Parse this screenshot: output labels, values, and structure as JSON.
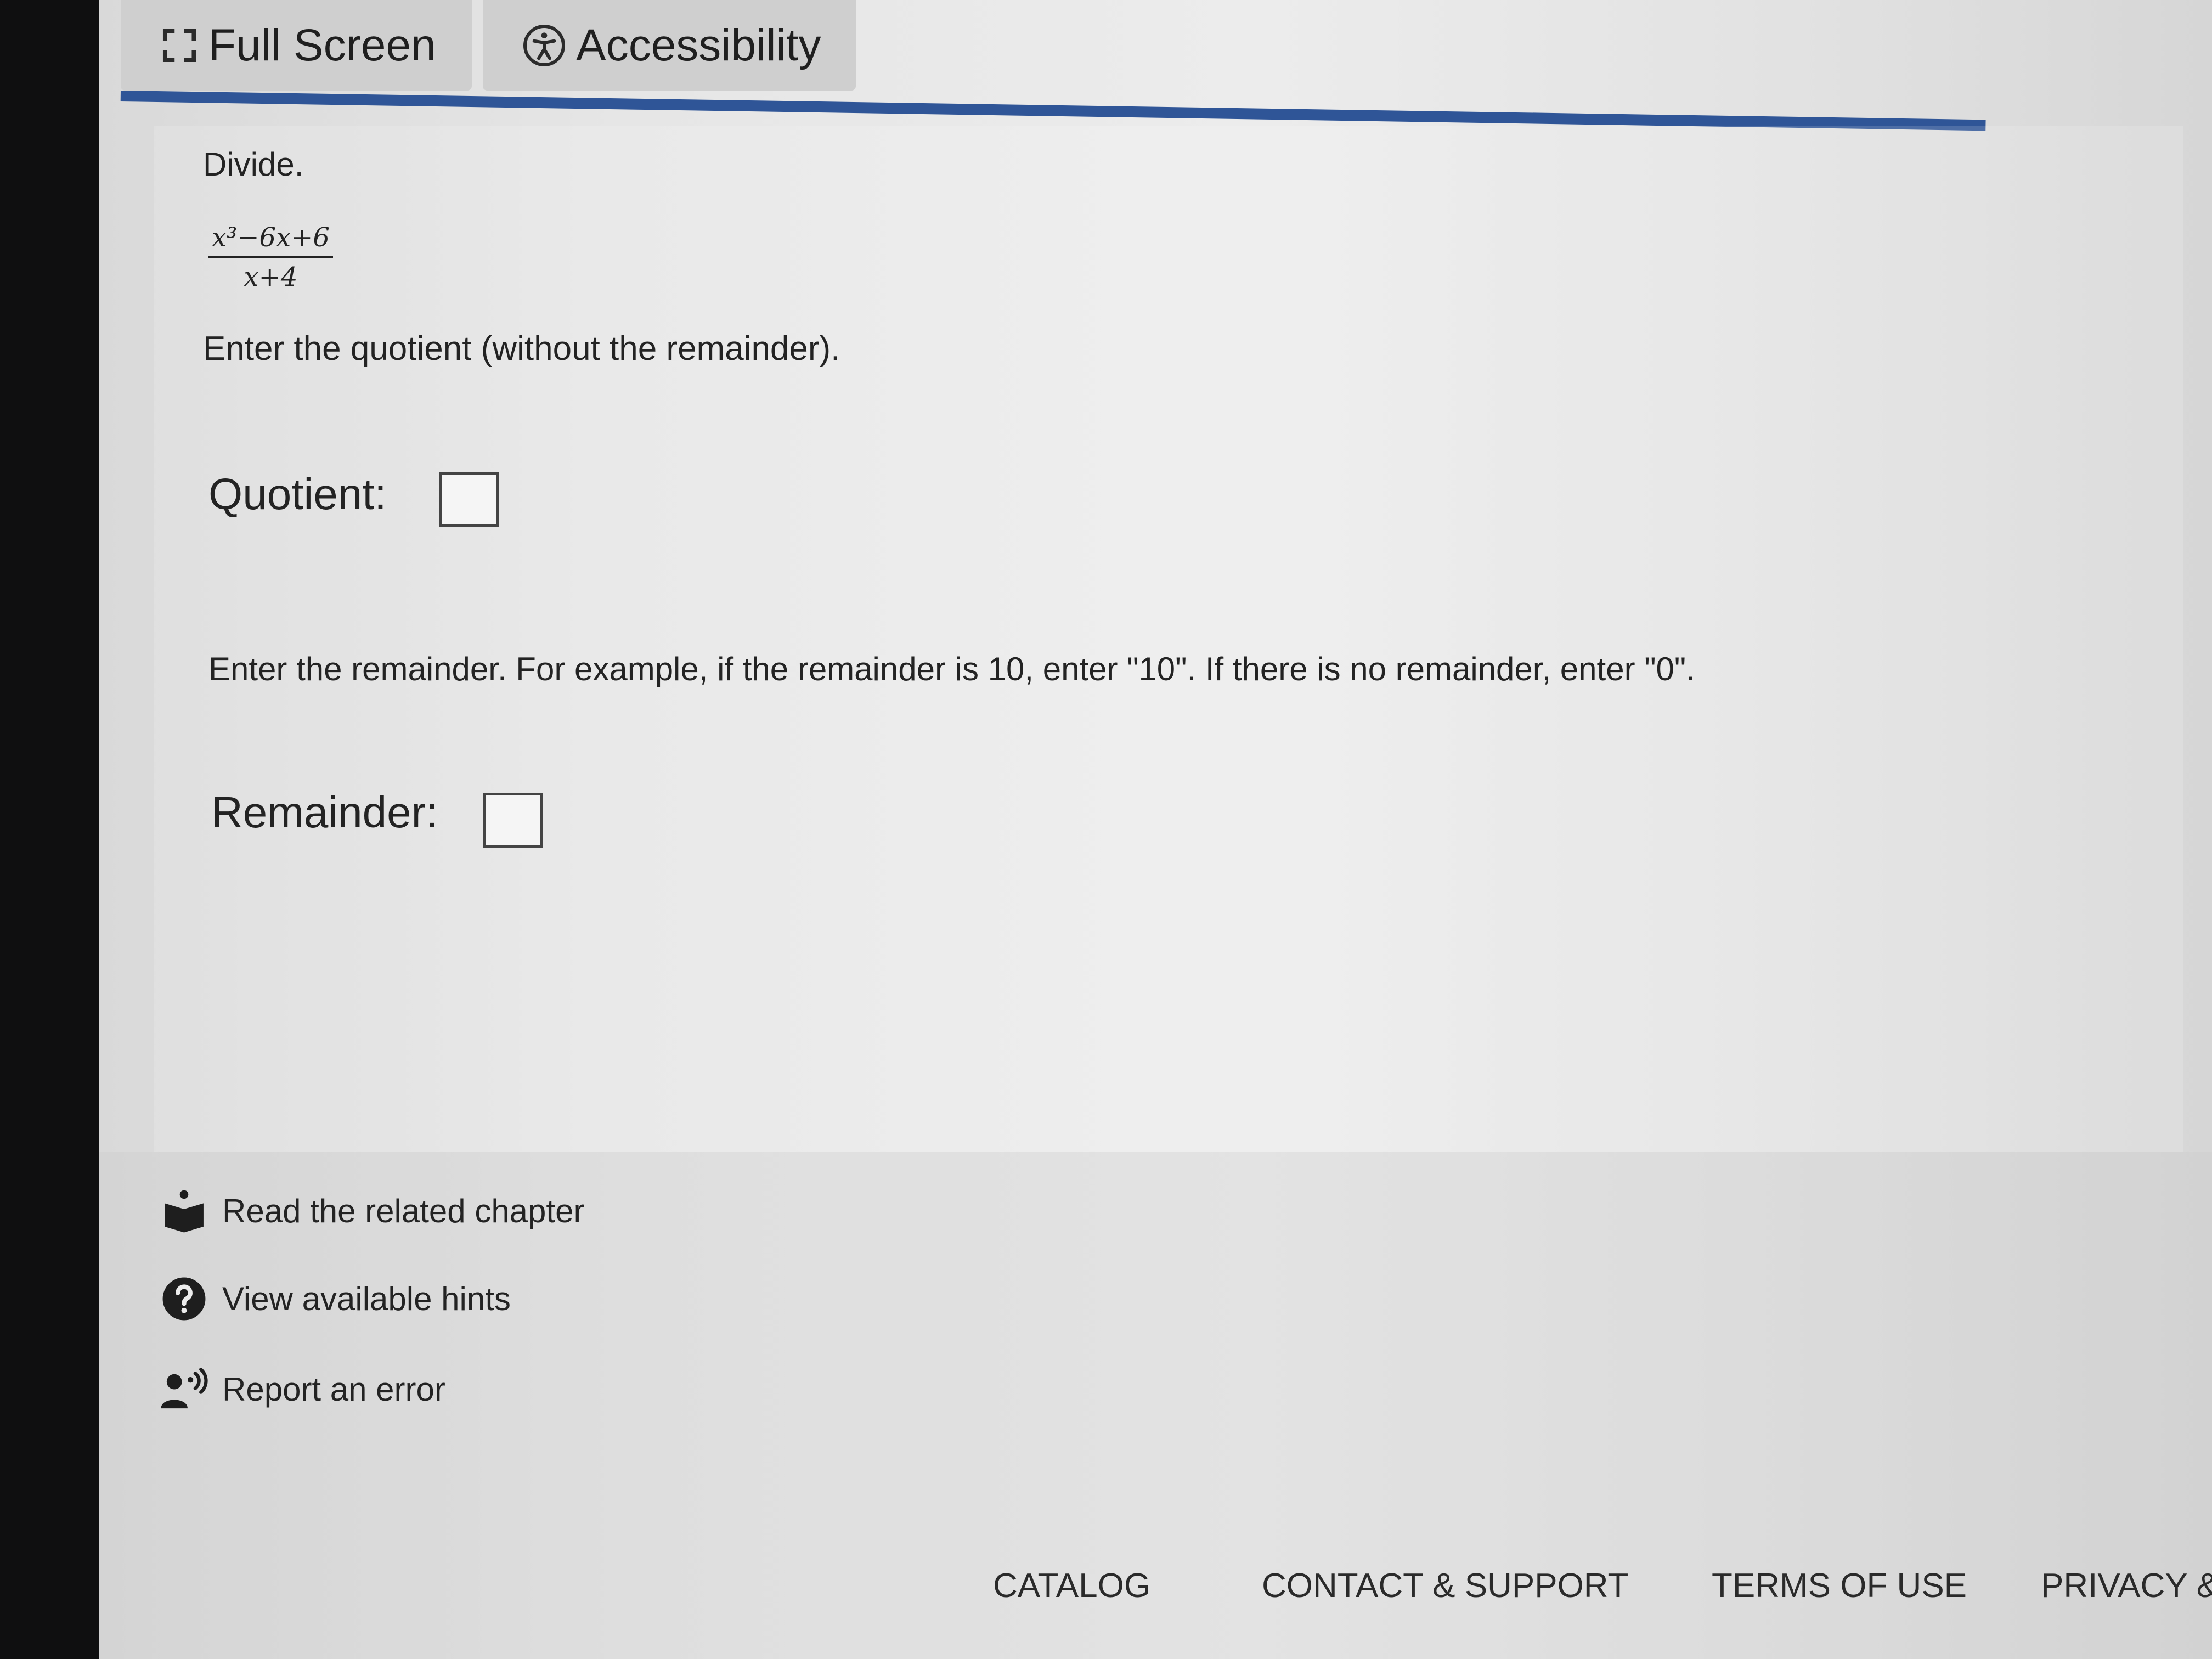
{
  "topbar": {
    "full_screen_label": "Full Screen",
    "accessibility_label": "Accessibility"
  },
  "question": {
    "prompt": "Divide.",
    "fraction_numerator": "x³−6x+6",
    "fraction_denominator": "x+4",
    "quotient_instruction": "Enter the quotient (without the remainder).",
    "quotient_label": "Quotient:",
    "quotient_value": "",
    "remainder_instruction": "Enter the remainder. For example, if the remainder is 10, enter \"10\". If there is no remainder, enter \"0\".",
    "remainder_label": "Remainder:",
    "remainder_value": ""
  },
  "help_links": [
    {
      "label": "Read the related chapter",
      "icon": "book-reader-icon"
    },
    {
      "label": "View available hints",
      "icon": "question-circle-icon"
    },
    {
      "label": "Report an error",
      "icon": "report-speaker-icon"
    }
  ],
  "footer_nav": [
    "CATALOG",
    "CONTACT & SUPPORT",
    "TERMS OF USE",
    "PRIVACY &"
  ],
  "colors": {
    "accent": "#2f5597",
    "text": "#232323",
    "background": "#e6e6e6"
  }
}
